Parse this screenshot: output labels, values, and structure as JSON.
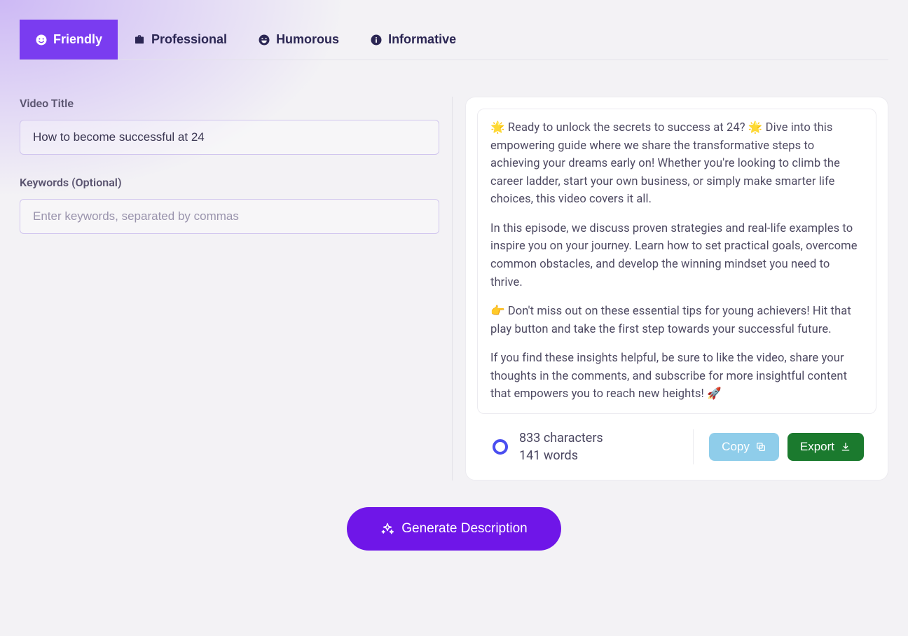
{
  "tabs": [
    {
      "label": "Friendly",
      "active": true
    },
    {
      "label": "Professional",
      "active": false
    },
    {
      "label": "Humorous",
      "active": false
    },
    {
      "label": "Informative",
      "active": false
    }
  ],
  "form": {
    "title_label": "Video Title",
    "title_value": "How to become successful at 24",
    "keywords_label": "Keywords (Optional)",
    "keywords_placeholder": "Enter keywords, separated by commas"
  },
  "output": {
    "paragraphs": [
      "🌟 Ready to unlock the secrets to success at 24? 🌟 Dive into this empowering guide where we share the transformative steps to achieving your dreams early on! Whether you're looking to climb the career ladder, start your own business, or simply make smarter life choices, this video covers it all.",
      "In this episode, we discuss proven strategies and real-life examples to inspire you on your journey. Learn how to set practical goals, overcome common obstacles, and develop the winning mindset you need to thrive.",
      "👉 Don't miss out on these essential tips for young achievers! Hit that play button and take the first step towards your successful future.",
      "If you find these insights helpful, be sure to like the video, share your thoughts in the comments, and subscribe for more insightful content that empowers you to reach new heights! 🚀"
    ],
    "stats": {
      "characters": "833 characters",
      "words": "141 words"
    },
    "copy_label": "Copy",
    "export_label": "Export"
  },
  "generate_label": "Generate Description"
}
